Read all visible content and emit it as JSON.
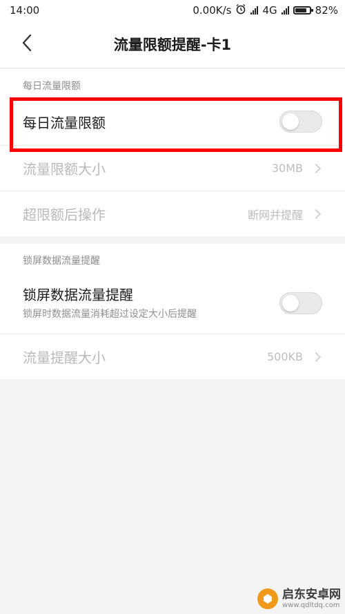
{
  "status_bar": {
    "time": "14:00",
    "net_speed": "0.00K/s",
    "network": "4G",
    "battery": "82%",
    "battery_level": 0.82
  },
  "header": {
    "title": "流量限额提醒-卡1",
    "back_icon": "chevron-left-icon"
  },
  "daily_section": {
    "header": "每日流量限额",
    "toggle_row": {
      "label": "每日流量限额",
      "enabled": false
    },
    "limit_row": {
      "label": "流量限额大小",
      "value": "30MB"
    },
    "action_row": {
      "label": "超限额后操作",
      "value": "断网并提醒"
    }
  },
  "lock_section": {
    "header": "锁屏数据流量提醒",
    "toggle_row": {
      "title": "锁屏数据流量提醒",
      "subtitle": "锁屏时数据流量消耗超过设定大小后提醒",
      "enabled": false
    },
    "size_row": {
      "label": "流量提醒大小",
      "value": "500KB"
    }
  },
  "watermark": {
    "main": "启东安卓网",
    "sub": "www.qdltdq.com"
  },
  "colors": {
    "highlight": "#ff0000",
    "background": "#f4f4f4",
    "brand_orange": "#f19a1a"
  }
}
